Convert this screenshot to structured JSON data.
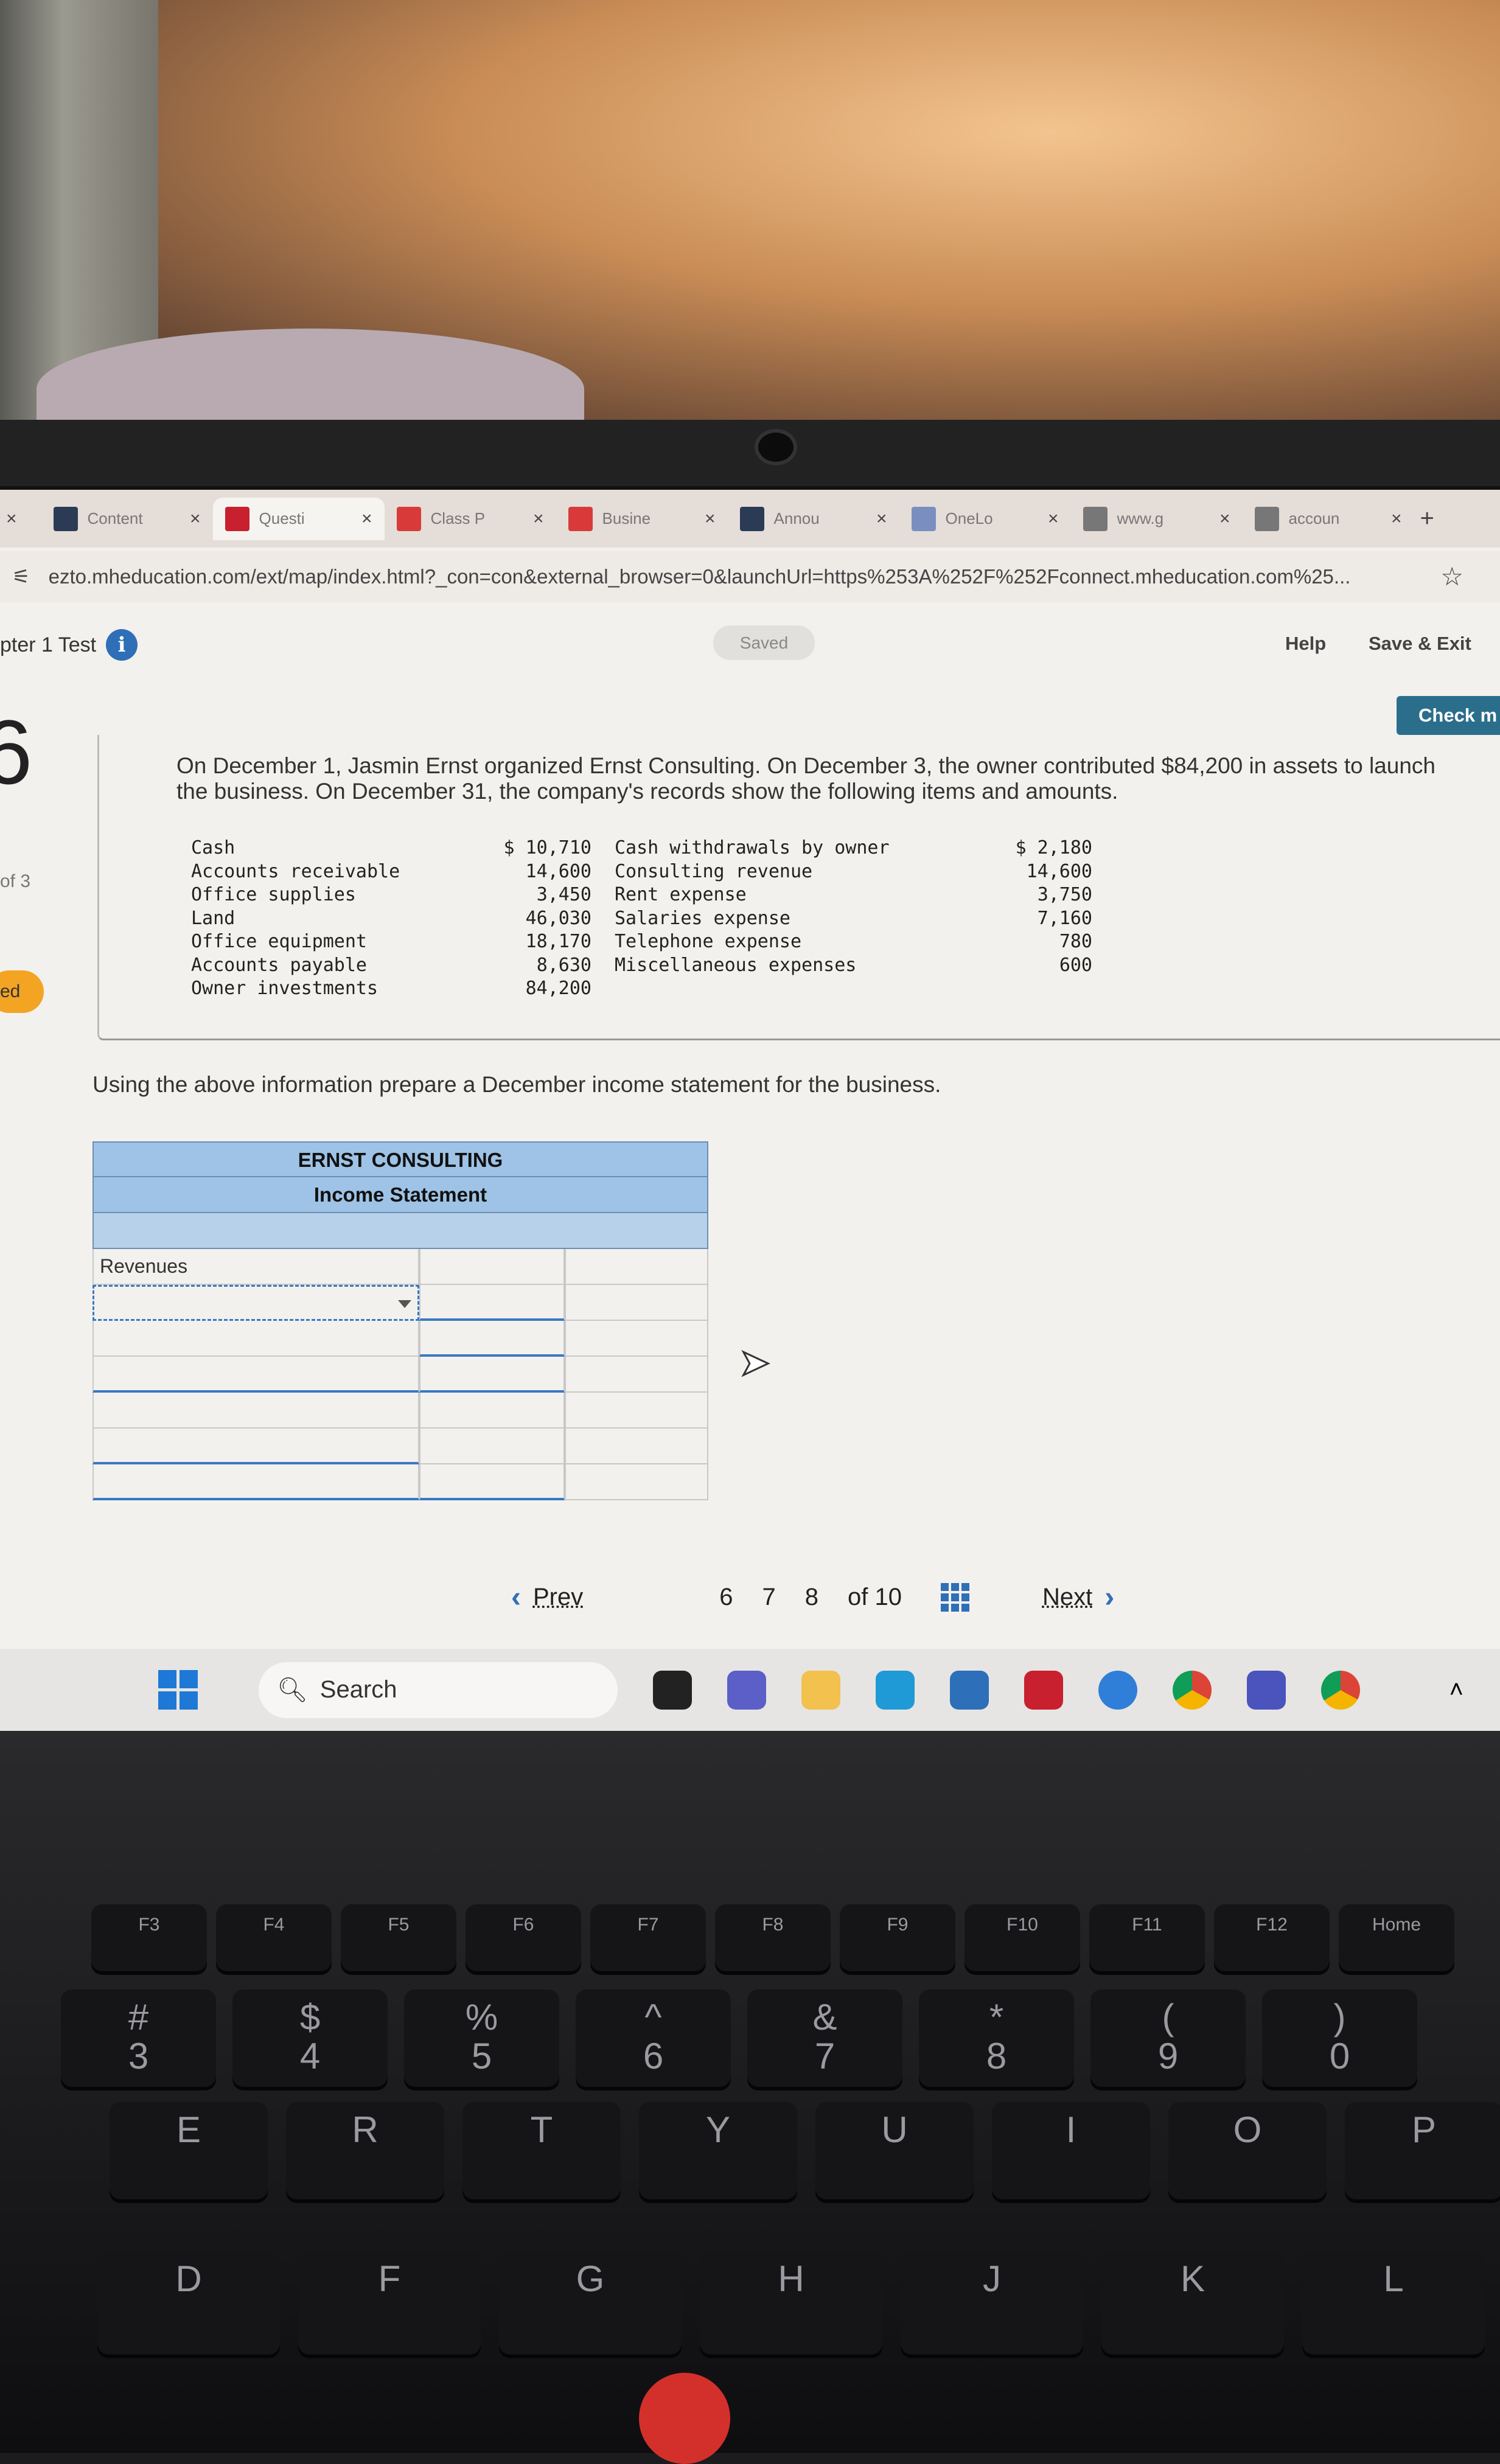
{
  "browser": {
    "tabs": [
      {
        "label": "Content",
        "color": "#2b3b55"
      },
      {
        "label": "Questi",
        "color": "#c8202f",
        "active": true
      },
      {
        "label": "Class P",
        "color": "#d83a3a"
      },
      {
        "label": "Busine",
        "color": "#d83a3a"
      },
      {
        "label": "Annou",
        "color": "#2b3b55"
      },
      {
        "label": "OneLo",
        "color": "#7a8fc0"
      },
      {
        "label": "www.g",
        "color": "#777777"
      },
      {
        "label": "accoun",
        "color": "#777777"
      }
    ],
    "tab_close": "×",
    "new_tab": "+",
    "url": "ezto.mheducation.com/ext/map/index.html?_con=con&external_browser=0&launchUrl=https%253A%252F%252Fconnect.mheducation.com%25..."
  },
  "header": {
    "title": "pter 1 Test",
    "saved": "Saved",
    "help": "Help",
    "save_exit": "Save & Exit",
    "check": "Check m"
  },
  "question": {
    "number": "6",
    "of": "of 3",
    "status": "ed",
    "text": "On December 1, Jasmin Ernst organized Ernst Consulting. On December 3, the owner contributed $84,200 in assets to launch the business. On December 31, the company's records show the following items and amounts.",
    "items_left": [
      {
        "label": "Cash",
        "amount": "$ 10,710"
      },
      {
        "label": "Accounts receivable",
        "amount": "14,600"
      },
      {
        "label": "Office supplies",
        "amount": "3,450"
      },
      {
        "label": "Land",
        "amount": "46,030"
      },
      {
        "label": "Office equipment",
        "amount": "18,170"
      },
      {
        "label": "Accounts payable",
        "amount": "8,630"
      },
      {
        "label": "Owner investments",
        "amount": "84,200"
      }
    ],
    "items_right": [
      {
        "label": "Cash withdrawals by owner",
        "amount": "$ 2,180"
      },
      {
        "label": "Consulting revenue",
        "amount": "14,600"
      },
      {
        "label": "Rent expense",
        "amount": "3,750"
      },
      {
        "label": "Salaries expense",
        "amount": "7,160"
      },
      {
        "label": "Telephone expense",
        "amount": "780"
      },
      {
        "label": "Miscellaneous expenses",
        "amount": "600"
      }
    ],
    "instruction": "Using the above information prepare a December income statement for the business."
  },
  "income_statement": {
    "company": "ERNST CONSULTING",
    "title": "Income Statement",
    "first_label": "Revenues"
  },
  "pager": {
    "prev": "Prev",
    "pages": [
      "6",
      "7",
      "8"
    ],
    "of": "of 10",
    "next": "Next"
  },
  "taskbar": {
    "search": "Search"
  },
  "keyboard": {
    "fkeys": [
      "F3",
      "F4",
      "F5",
      "F6",
      "F7",
      "F8",
      "F9",
      "F10",
      "F11",
      "F12",
      "Home"
    ],
    "numkeys": [
      "#\n3",
      "$\n4",
      "%\n5",
      "^\n6",
      "&\n7",
      "*\n8",
      "(\n9",
      ")\n0"
    ],
    "row2": [
      "E",
      "R",
      "T",
      "Y",
      "U",
      "I",
      "O",
      "P"
    ],
    "row3": [
      "D",
      "F",
      "G",
      "H",
      "J",
      "K",
      "L"
    ]
  }
}
